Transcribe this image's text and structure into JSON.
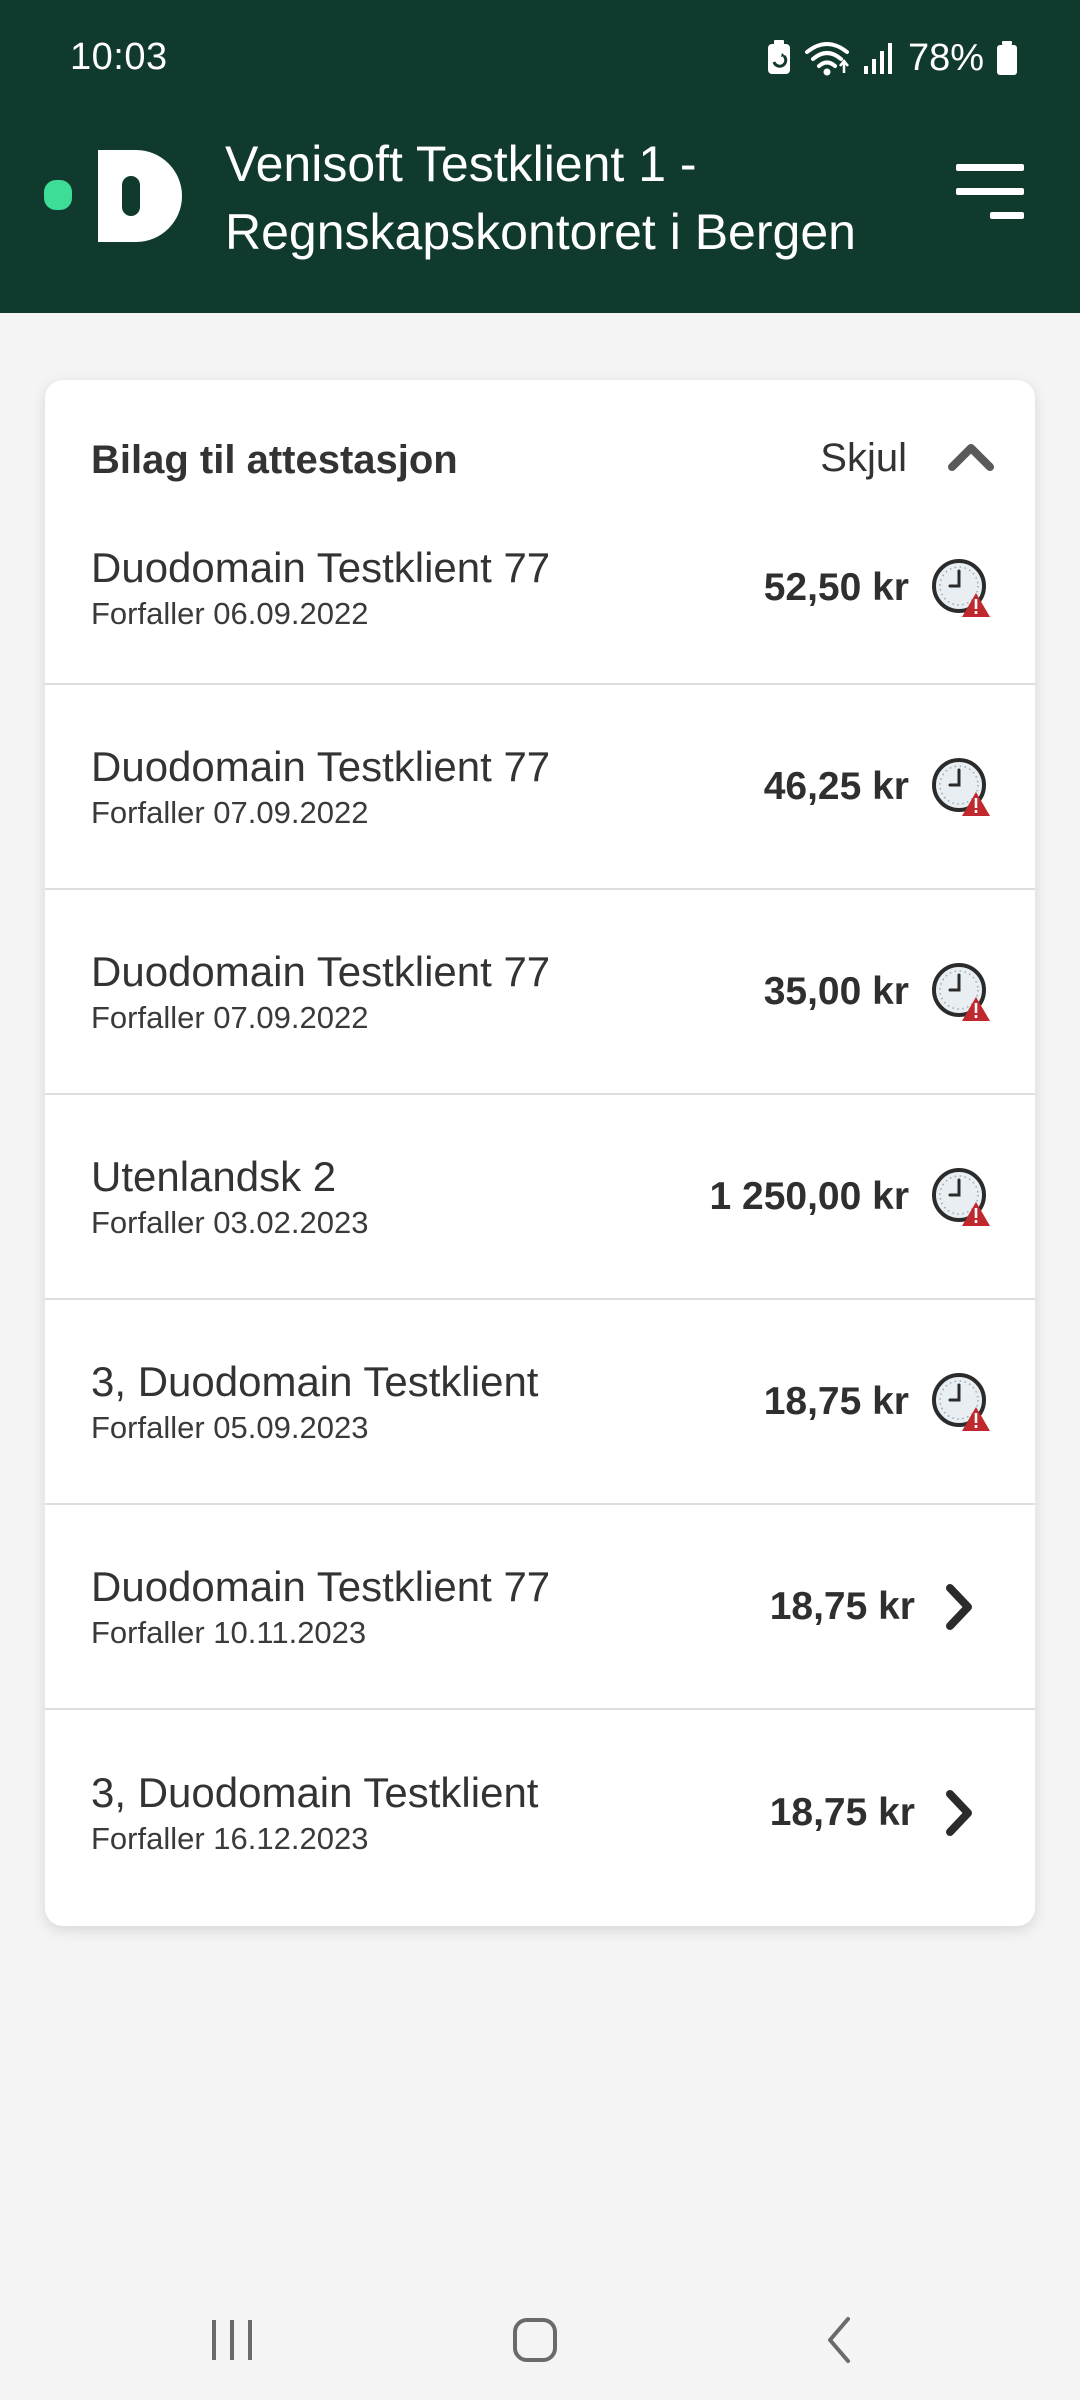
{
  "status_bar": {
    "time": "10:03",
    "battery": "78%",
    "icons": [
      "battery-saver-icon",
      "wifi-icon",
      "signal-icon",
      "battery-icon"
    ]
  },
  "header": {
    "logo_letter": "D",
    "title_line1": "Venisoft Testklient 1 -",
    "title_line2": "Regnskapskontoret i Bergen",
    "menu_icon": "hamburger-menu-icon"
  },
  "card": {
    "title": "Bilag til attestasjon",
    "toggle_label": "Skjul",
    "toggle_icon": "chevron-up-icon",
    "items": [
      {
        "name": "Duodomain Testklient 77",
        "due": "Forfaller 06.09.2022",
        "amount": "52,50 kr",
        "icon": "overdue-clock-icon"
      },
      {
        "name": "Duodomain Testklient 77",
        "due": "Forfaller 07.09.2022",
        "amount": "46,25 kr",
        "icon": "overdue-clock-icon"
      },
      {
        "name": "Duodomain Testklient 77",
        "due": "Forfaller 07.09.2022",
        "amount": "35,00 kr",
        "icon": "overdue-clock-icon"
      },
      {
        "name": "Utenlandsk 2",
        "due": "Forfaller 03.02.2023",
        "amount": "1 250,00 kr",
        "icon": "overdue-clock-icon"
      },
      {
        "name": "3, Duodomain Testklient",
        "due": "Forfaller 05.09.2023",
        "amount": "18,75 kr",
        "icon": "overdue-clock-icon"
      },
      {
        "name": "Duodomain Testklient 77",
        "due": "Forfaller 10.11.2023",
        "amount": "18,75 kr",
        "icon": "chevron-right-icon"
      },
      {
        "name": "3, Duodomain Testklient",
        "due": "Forfaller 16.12.2023",
        "amount": "18,75 kr",
        "icon": "chevron-right-icon"
      }
    ]
  },
  "nav_bar": {
    "buttons": [
      "recent-apps-icon",
      "home-icon",
      "back-icon"
    ]
  },
  "colors": {
    "header_bg": "#103a2e",
    "logo_accent": "#3ddc97",
    "page_bg": "#f4f4f4",
    "warning_red": "#c0282d"
  }
}
